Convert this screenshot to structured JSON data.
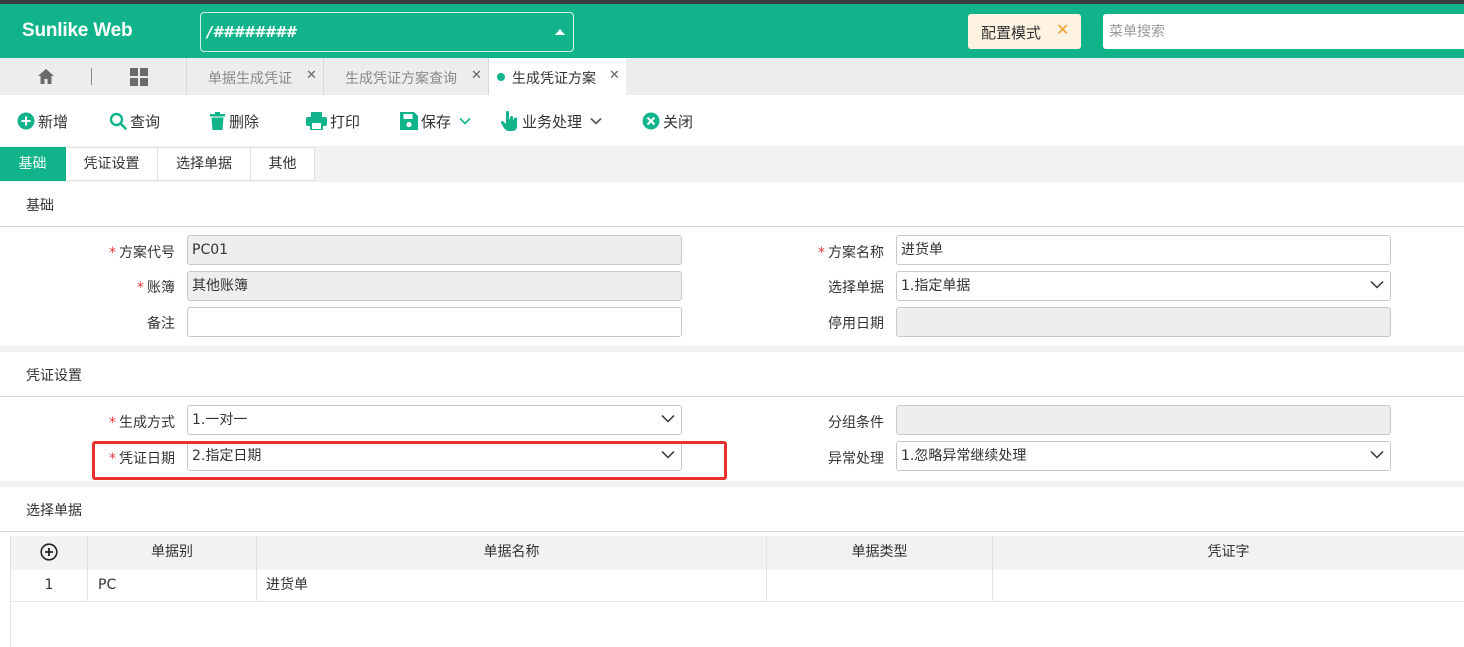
{
  "app": {
    "brand": "Sunlike Web",
    "account_value": "/########",
    "config_mode_label": "配置模式",
    "menu_search_placeholder": "菜单搜索"
  },
  "tabs": [
    {
      "label": "单据生成凭证",
      "active": false
    },
    {
      "label": "生成凭证方案查询",
      "active": false
    },
    {
      "label": "生成凭证方案",
      "active": true
    }
  ],
  "toolbar": {
    "new": "新增",
    "query": "查询",
    "delete": "删除",
    "print": "打印",
    "save": "保存",
    "business": "业务处理",
    "close": "关闭"
  },
  "section_tabs": [
    "基础",
    "凭证设置",
    "选择单据",
    "其他"
  ],
  "basic": {
    "title": "基础",
    "scheme_code_label": "方案代号",
    "scheme_code_value": "PC01",
    "scheme_name_label": "方案名称",
    "scheme_name_value": "进货单",
    "ledger_label": "账簿",
    "ledger_value": "其他账簿",
    "select_doc_label": "选择单据",
    "select_doc_value": "1.指定单据",
    "remark_label": "备注",
    "remark_value": "",
    "disable_date_label": "停用日期",
    "disable_date_value": ""
  },
  "voucher": {
    "title": "凭证设置",
    "gen_method_label": "生成方式",
    "gen_method_value": "1.一对一",
    "group_cond_label": "分组条件",
    "group_cond_value": "",
    "voucher_date_label": "凭证日期",
    "voucher_date_value": "2.指定日期",
    "exception_label": "异常处理",
    "exception_value": "1.忽略异常继续处理"
  },
  "docs": {
    "title": "选择单据",
    "columns": [
      "单据别",
      "单据名称",
      "单据类型",
      "凭证字"
    ],
    "rows": [
      {
        "no": "1",
        "code": "PC",
        "name": "进货单",
        "type": "",
        "voucher_word": ""
      }
    ]
  },
  "colors": {
    "brand": "#11b48a",
    "required": "#e4393c",
    "highlight": "#e8302c",
    "config": "#f0a02c"
  }
}
